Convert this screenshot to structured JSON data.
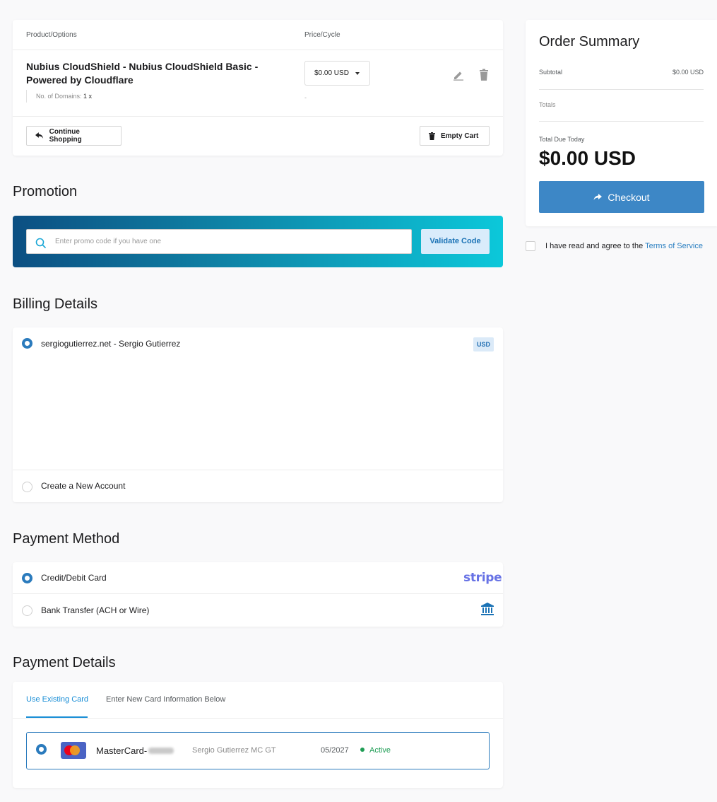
{
  "cart": {
    "col_product": "Product/Options",
    "col_price": "Price/Cycle",
    "item": {
      "name": "Nubius CloudShield - Nubius CloudShield Basic - Powered by Cloudflare",
      "option_label": "No. of Domains:",
      "option_value": "1 x",
      "price": "$0.00 USD",
      "price_sub": "-"
    },
    "continue_label": "Continue Shopping",
    "empty_label": "Empty Cart",
    "icons": {
      "edit": "pencil-icon",
      "delete": "trash-icon",
      "back": "reply-arrow-icon"
    }
  },
  "promotion": {
    "title": "Promotion",
    "placeholder": "Enter promo code if you have one",
    "validate_label": "Validate Code"
  },
  "billing": {
    "title": "Billing Details",
    "account": "sergiogutierrez.net - Sergio Gutierrez",
    "currency_badge": "USD",
    "new_account": "Create a New Account"
  },
  "payment_method": {
    "title": "Payment Method",
    "options": [
      {
        "label": "Credit/Debit Card",
        "selected": true,
        "logo": "stripe"
      },
      {
        "label": "Bank Transfer (ACH or Wire)",
        "selected": false,
        "logo": "bank-icon"
      }
    ]
  },
  "payment_details": {
    "title": "Payment Details",
    "tabs": [
      "Use Existing Card",
      "Enter New Card Information Below"
    ],
    "card": {
      "brand": "MasterCard-",
      "holder": "Sergio Gutierrez MC GT",
      "expiry": "05/2027",
      "status": "Active"
    }
  },
  "summary": {
    "title": "Order Summary",
    "subtotal_label": "Subtotal",
    "subtotal_value": "$0.00 USD",
    "totals_label": "Totals",
    "due_label": "Total Due Today",
    "due_value": "$0.00 USD",
    "checkout_label": "Checkout"
  },
  "tos": {
    "prefix": "I have read and agree to the",
    "link": "Terms of Service"
  },
  "colors": {
    "accent": "#3d87c6",
    "active_tab": "#1a8ed6",
    "status_green": "#1f9d55",
    "stripe": "#6772e5"
  }
}
